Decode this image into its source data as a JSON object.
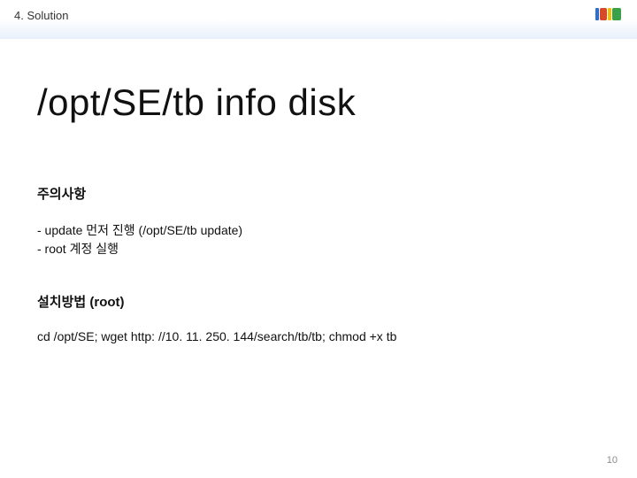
{
  "header": {
    "section_label": "4. Solution",
    "logo_name": "daum-logo"
  },
  "title": "/opt/SE/tb info disk",
  "caution": {
    "heading": "주의사항",
    "line1": "- update 먼저 진행 (/opt/SE/tb update)",
    "line2": "- root 계정 실행"
  },
  "install": {
    "heading": "설치방법 (root)",
    "command": "cd /opt/SE; wget http: //10. 11. 250. 144/search/tb/tb; chmod +x tb"
  },
  "page_number": "10"
}
